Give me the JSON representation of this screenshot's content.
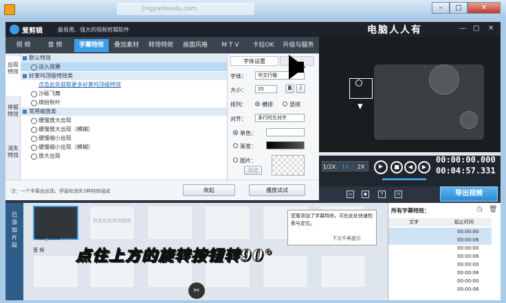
{
  "browser": {
    "address": "jingyanbaidu.com"
  },
  "app": {
    "name": "爱剪辑",
    "slogan": "最易用、强大的视频剪辑软件",
    "watermark": "电脑人人有"
  },
  "tabs": [
    "视 频",
    "音 频",
    "字幕特效",
    "叠加素材",
    "转场特效",
    "画面风格",
    "M T V",
    "卡拉OK",
    "升级与服务"
  ],
  "vtabs": [
    "出现特效",
    "停留特效",
    "消失特效"
  ],
  "effects": [
    {
      "type": "cat",
      "text": "默认特效"
    },
    {
      "type": "item",
      "text": "淡入效果",
      "selected": true
    },
    {
      "type": "cat",
      "text": "好莱坞顶级特效类"
    },
    {
      "type": "link",
      "text": "点击此处获取更多好莱坞顶级特效"
    },
    {
      "type": "item",
      "text": "沙砾飞舞"
    },
    {
      "type": "item",
      "text": "缤纷秋叶"
    },
    {
      "type": "cat",
      "text": "常用缩放类"
    },
    {
      "type": "item",
      "text": "缓慢放大出现"
    },
    {
      "type": "item",
      "text": "缓慢放大出现（模糊）"
    },
    {
      "type": "item",
      "text": "缓慢缩小出现"
    },
    {
      "type": "item",
      "text": "缓慢缩小出现（模糊）"
    },
    {
      "type": "item",
      "text": "放大出现"
    }
  ],
  "footer": {
    "note": "注：一个字幕由出现、停留和消失3种特效组成",
    "collapse": "收起",
    "play_test": "播放试试"
  },
  "settings": {
    "tab": "字体设置",
    "font_label": "字体：",
    "font": "华文行楷",
    "size_label": "大小：",
    "size": "35",
    "bold": "B",
    "italic": "I",
    "arr_label": "排列：",
    "arr_h": "横排",
    "arr_v": "竖排",
    "align_label": "对齐：",
    "align": "多行时左对齐",
    "single": "单色：",
    "gradient": "渐变：",
    "image": "图片：",
    "browse": "浏览"
  },
  "player": {
    "speeds": [
      "1/2X",
      "1X",
      "2X"
    ],
    "time_current": "00:00:00.000",
    "time_total": "00:04:57.331"
  },
  "export": "导出视频",
  "timeline": {
    "side_label": "已添加片段",
    "clip_name": "IMG_0458",
    "placeholder": "双击此处添加视频",
    "audio": "音 频"
  },
  "tip": {
    "text": "您看添加了字幕特效，可在此处快速检索与定位。",
    "dont_show": "下次不再提示"
  },
  "subpanel": {
    "title": "所有字幕特效：",
    "col_text": "文字",
    "col_time": "起止时间",
    "times": [
      "00:00:00",
      "00:00:06",
      "00:00:00",
      "00:00:06",
      "00:00:00",
      "00:00:06",
      "00:00:00",
      "00:00:06"
    ]
  },
  "overlay": "点住上方的旋转按钮转90°"
}
